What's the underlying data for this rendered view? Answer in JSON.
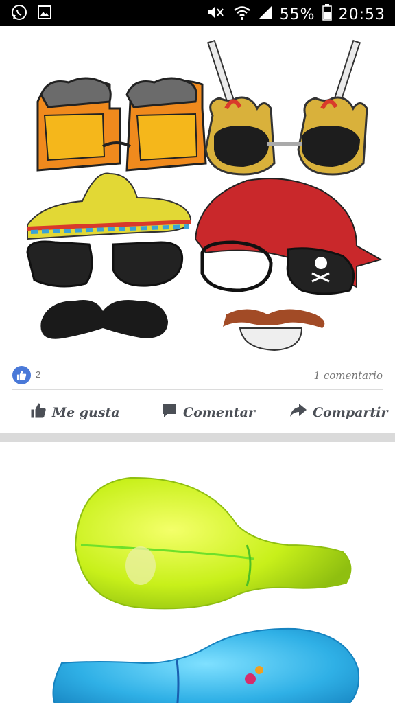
{
  "status_bar": {
    "battery": "55%",
    "time": "20:53",
    "icons": [
      "whatsapp-icon",
      "gallery-icon",
      "mute-icon",
      "wifi-icon",
      "signal-icon",
      "battery-icon"
    ]
  },
  "post1": {
    "like_count": "2",
    "comments": "1 comentario",
    "actions": {
      "like": "Me gusta",
      "comment": "Comentar",
      "share": "Compartir"
    }
  },
  "colors": {
    "facebook_blue": "#4a79d8",
    "action_gray": "#4b4f56",
    "separator": "#dadada"
  }
}
